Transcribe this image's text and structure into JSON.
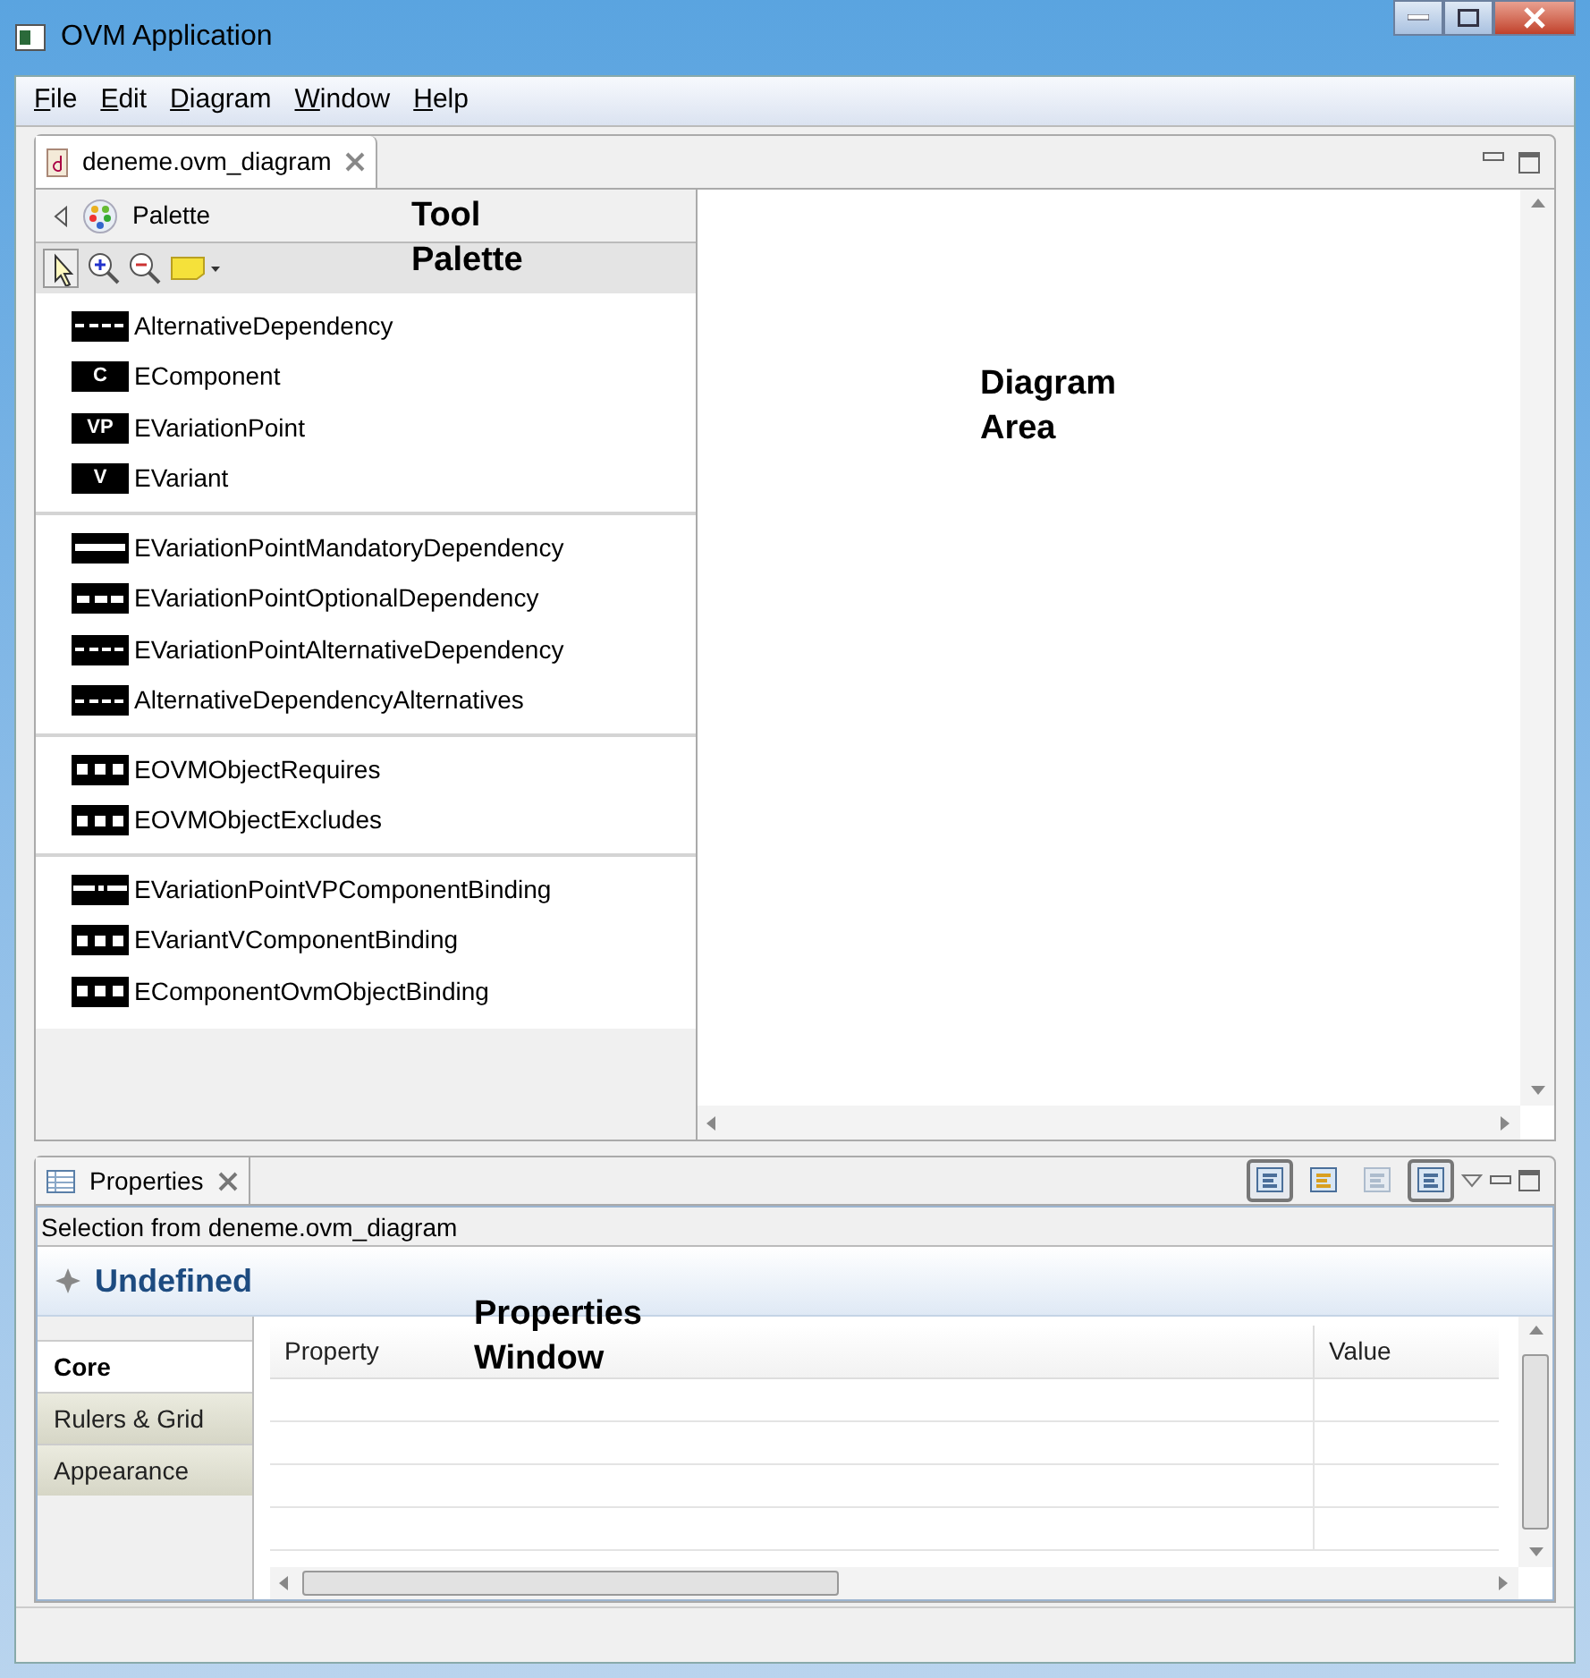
{
  "window": {
    "title": "OVM Application"
  },
  "menu": [
    "File",
    "Edit",
    "Diagram",
    "Window",
    "Help"
  ],
  "editor_tab": {
    "label": "deneme.ovm_diagram"
  },
  "palette": {
    "title": "Palette",
    "groups": [
      [
        {
          "label": "AlternativeDependency",
          "kind": "dashed"
        },
        {
          "label": "EComponent",
          "kind": "letter",
          "icon_text": "C"
        },
        {
          "label": "EVariationPoint",
          "kind": "letter",
          "icon_text": "VP"
        },
        {
          "label": "EVariant",
          "kind": "letter",
          "icon_text": "V"
        }
      ],
      [
        {
          "label": "EVariationPointMandatoryDependency",
          "kind": "solid"
        },
        {
          "label": "EVariationPointOptionalDependency",
          "kind": "wide-dashed"
        },
        {
          "label": "EVariationPointAlternativeDependency",
          "kind": "dashed"
        },
        {
          "label": "AlternativeDependencyAlternatives",
          "kind": "dashed"
        }
      ],
      [
        {
          "label": "EOVMObjectRequires",
          "kind": "blocks"
        },
        {
          "label": "EOVMObjectExcludes",
          "kind": "blocks"
        }
      ],
      [
        {
          "label": "EVariationPointVPComponentBinding",
          "kind": "dash-dot"
        },
        {
          "label": "EVariantVComponentBinding",
          "kind": "blocks"
        },
        {
          "label": "EComponentOvmObjectBinding",
          "kind": "blocks"
        }
      ]
    ]
  },
  "annotations": {
    "palette": "Tool Palette",
    "diagram": "Diagram Area",
    "properties": "Properties Window"
  },
  "properties": {
    "tab": "Properties",
    "toolbar": [
      {
        "pressed": true,
        "disabled": false
      },
      {
        "pressed": false,
        "disabled": false
      },
      {
        "pressed": false,
        "disabled": true
      },
      {
        "pressed": true,
        "disabled": false
      }
    ],
    "selection": "Selection from deneme.ovm_diagram",
    "heading": "Undefined",
    "tabs": [
      {
        "label": "Core",
        "selected": true
      },
      {
        "label": "Rulers & Grid",
        "selected": false
      },
      {
        "label": "Appearance",
        "selected": false
      }
    ],
    "columns": [
      "Property",
      "Value"
    ]
  }
}
